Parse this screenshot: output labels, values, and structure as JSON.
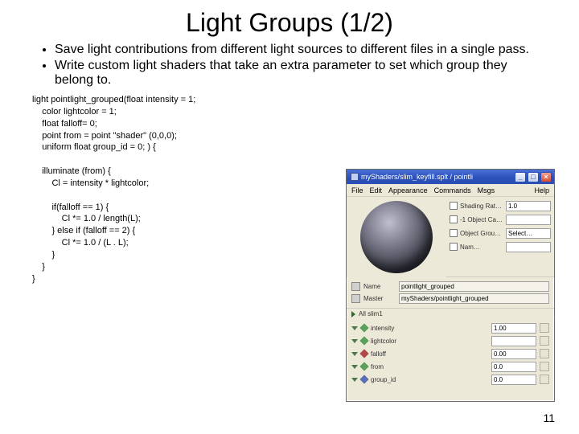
{
  "title": "Light Groups (1/2)",
  "bullets": [
    "Save light contributions from different light sources to different files in a single pass.",
    "Write custom light shaders that take an extra parameter to set which group they belong to."
  ],
  "code": "light pointlight_grouped(float intensity = 1;\n    color lightcolor = 1;\n    float falloff= 0;\n    point from = point \"shader\" (0,0,0);\n    uniform float group_id = 0; ) {\n\n    illuminate (from) {\n        Cl = intensity * lightcolor;\n\n        if(falloff == 1) {\n            Cl *= 1.0 / length(L);\n        } else if (falloff == 2) {\n            Cl *= 1.0 / (L . L);\n        }\n    }\n}",
  "page_number": "11",
  "window": {
    "title": "myShaders/slim_keyfill.splt / pointli",
    "menu_left": [
      "File",
      "Edit",
      "Appearance",
      "Commands",
      "Msgs"
    ],
    "menu_right": "Help",
    "top_params": [
      {
        "label": "Shading Rat…",
        "value": "1.0"
      },
      {
        "label": "-1 Object Ca…",
        "value": ""
      },
      {
        "label": "Object Grou…",
        "value": "Select…"
      },
      {
        "label": "Nam…",
        "value": ""
      }
    ],
    "meta": [
      {
        "label": "Name",
        "value": "pointlight_grouped"
      },
      {
        "label": "Master",
        "value": "myShaders/pointlight_grouped"
      }
    ],
    "all_slim": "All slim1",
    "shader_params": [
      {
        "label": "intensity",
        "value": "1.00",
        "color": "green",
        "swatch": false
      },
      {
        "label": "lightcolor",
        "value": "",
        "color": "green",
        "swatch": true
      },
      {
        "label": "falloff",
        "value": "0.00",
        "color": "red",
        "swatch": false
      },
      {
        "label": "from",
        "value": "0.0",
        "color": "green",
        "swatch": false
      },
      {
        "label": "group_id",
        "value": "0.0",
        "color": "blue",
        "swatch": false
      }
    ],
    "btn_min": "_",
    "btn_max": "□",
    "btn_close": "×"
  }
}
